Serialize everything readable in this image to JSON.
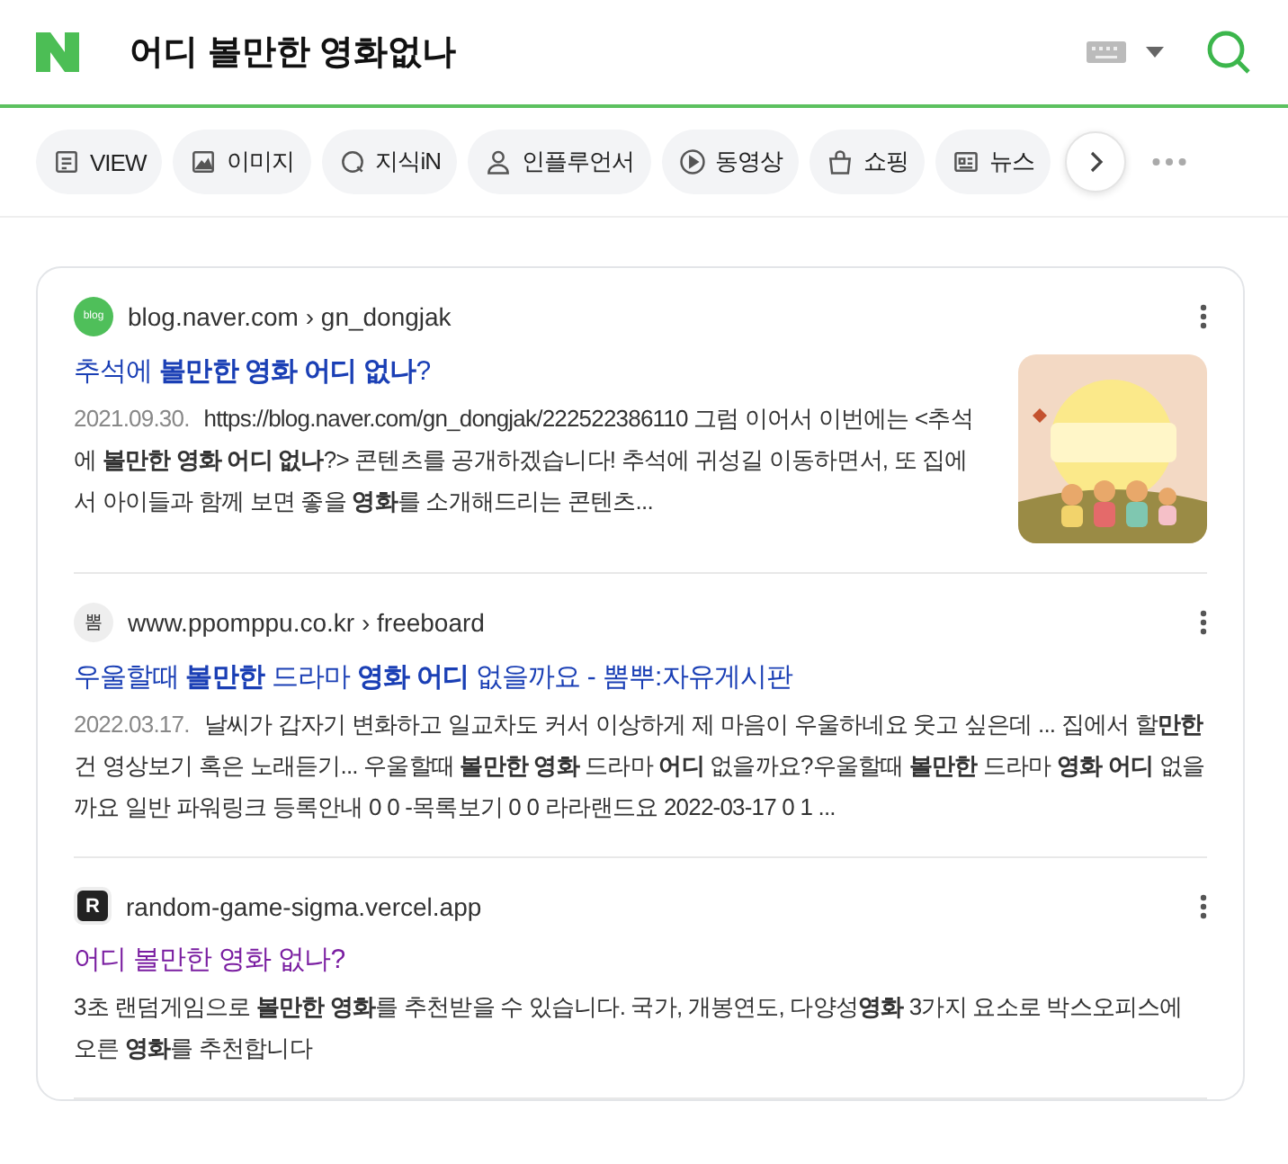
{
  "search_bar": {
    "query": "어디 볼만한 영화없나"
  },
  "tabs": [
    {
      "label": "VIEW"
    },
    {
      "label": "이미지"
    },
    {
      "label": "지식iN"
    },
    {
      "label": "인플루언서"
    },
    {
      "label": "동영상"
    },
    {
      "label": "쇼핑"
    },
    {
      "label": "뉴스"
    }
  ],
  "results": [
    {
      "site_badge": "blog",
      "source": "blog.naver.com",
      "separator": "›",
      "path": "gn_dongjak",
      "title": "추석에 **볼만한 영화 어디 없나**?",
      "visited": false,
      "date": "2021.09.30.",
      "snippet": "https://blog.naver.com/gn_dongjak/222522386110 그럼 이어서 이번에는 <추석에 **볼만한 영화 어디 없나**?> 콘텐츠를 공개하겠습니다! 추석에 귀성길 이동하면서, 또 집에서 아이들과 함께 보면 좋을 **영화**를 소개해드리는 콘텐츠..."
    },
    {
      "site_badge": "뽐",
      "source": "www.ppomppu.co.kr",
      "separator": "›",
      "path": "freeboard",
      "title": "우울할때 **볼만한** 드라마 **영화 어디** 없을까요 - 뽐뿌:자유게시판",
      "visited": false,
      "date": "2022.03.17.",
      "snippet": "날씨가 갑자기 변화하고 일교차도 커서 이상하게 제 마음이 우울하네요 웃고 싶은데 ... 집에서 할**만한**건 영상보기 혹은 노래듣기... 우울할때 **볼만한 영화** 드라마 **어디** 없을까요?우울할때 **볼만한** 드라마 **영화 어디** 없을까요 일반 파워링크 등록안내 0 0 -목록보기 0 0 라라랜드요 2022-03-17 0 1 ..."
    },
    {
      "site_badge": "R",
      "source": "random-game-sigma.vercel.app",
      "title": "어디 볼만한 영화 없나?",
      "visited": true,
      "snippet": "3초 랜덤게임으로 **볼만한 영화**를 추천받을 수 있습니다. 국가, 개봉연도, 다양성**영화** 3가지 요소로 박스오피스에 오른 **영화**를 추천합니다"
    }
  ]
}
